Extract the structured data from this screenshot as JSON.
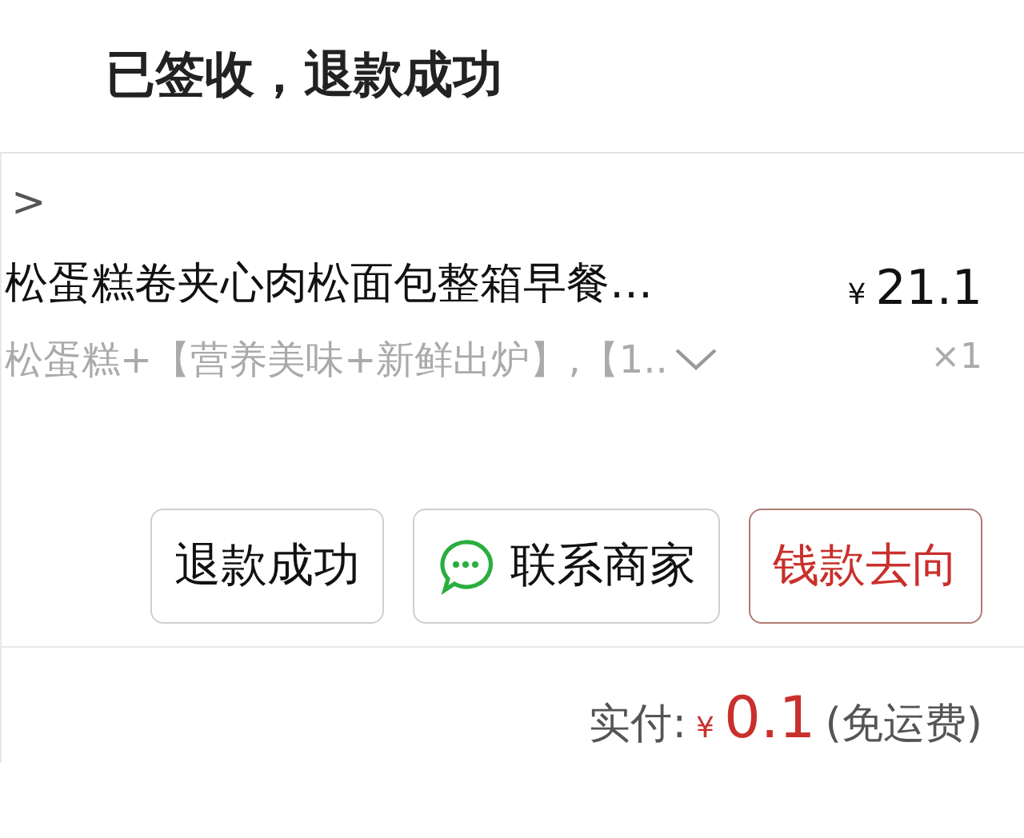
{
  "header": {
    "title": "已签收，退款成功"
  },
  "product": {
    "back": ">",
    "title": "松蛋糕卷夹心肉松面包整箱早餐…",
    "spec": "松蛋糕+【营养美味+新鲜出炉】,【1..",
    "currency": "¥",
    "price": "21.1",
    "quantity": "×1"
  },
  "buttons": [
    {
      "label": "退款成功",
      "kind": "plain"
    },
    {
      "label": "联系商家",
      "kind": "chat"
    },
    {
      "label": "钱款去向",
      "kind": "accent"
    }
  ],
  "total": {
    "label": "实付:",
    "currency": "¥",
    "amount": "0.1",
    "note": "(免运费)"
  }
}
